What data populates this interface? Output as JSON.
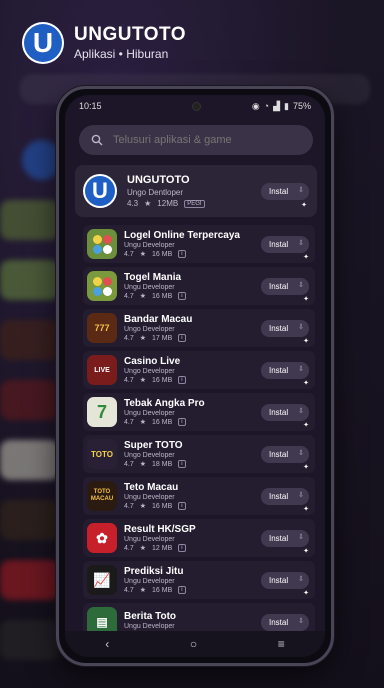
{
  "header": {
    "logo_letter": "U",
    "title": "UNGUTOTO",
    "subtitle": "Aplikasi • Hiburan"
  },
  "status_bar": {
    "time": "10:15",
    "battery": "75%"
  },
  "search": {
    "placeholder": "Telusuri aplikasi & game"
  },
  "featured": {
    "icon_letter": "U",
    "name": "UNGUTOTO",
    "developer": "Ungo Dentloper",
    "rating": "4.3",
    "size": "12MB",
    "badge": "PEGI",
    "install_label": "Instal"
  },
  "apps": [
    {
      "name": "Logel Online Terpercaya",
      "developer": "Ungu Developer",
      "rating": "4.7",
      "size": "16 MB",
      "install_label": "Instal",
      "icon": "lottery-balls-icon",
      "color": "#6b8f3a"
    },
    {
      "name": "Togel Mania",
      "developer": "Ungu Developer",
      "rating": "4.7",
      "size": "16 MB",
      "install_label": "Instal",
      "icon": "lottery-balls-icon",
      "color": "#7a9a3c"
    },
    {
      "name": "Bandar Macau",
      "developer": "Ungo Developer",
      "rating": "4.7",
      "size": "17 MB",
      "install_label": "Instal",
      "icon": "slot-machine-icon",
      "color": "#5a2a14"
    },
    {
      "name": "Casino Live",
      "developer": "Ungo Developer",
      "rating": "4.7",
      "size": "16 MB",
      "install_label": "Instal",
      "icon": "casino-live-icon",
      "color": "#7a1c1c"
    },
    {
      "name": "Tebak Angka Pro",
      "developer": "Ungu Developer",
      "rating": "4.7",
      "size": "16 MB",
      "install_label": "Instal",
      "icon": "number-seven-icon",
      "color": "#e6e6d8"
    },
    {
      "name": "Super TOTO",
      "developer": "Ungo Developer",
      "rating": "4.7",
      "size": "18 MB",
      "install_label": "Instal",
      "icon": "toto-badge-icon",
      "color": "#2a2036"
    },
    {
      "name": "Teto Macau",
      "developer": "Ungu Developer",
      "rating": "4.7",
      "size": "16 MB",
      "install_label": "Instal",
      "icon": "toto-macau-icon",
      "color": "#2a1a10"
    },
    {
      "name": "Result HK/SGP",
      "developer": "Ungu Developer",
      "rating": "4.7",
      "size": "12 MB",
      "install_label": "Instal",
      "icon": "hk-flag-icon",
      "color": "#c8202a"
    },
    {
      "name": "Prediksi Jitu",
      "developer": "Ungu Developer",
      "rating": "4.7",
      "size": "16 MB",
      "install_label": "Instal",
      "icon": "chart-up-icon",
      "color": "#1a1a1a"
    },
    {
      "name": "Berita Toto",
      "developer": "Ungu Developer",
      "rating": "",
      "size": "",
      "install_label": "Instal",
      "icon": "news-icon",
      "color": "#2e6b3a"
    }
  ]
}
